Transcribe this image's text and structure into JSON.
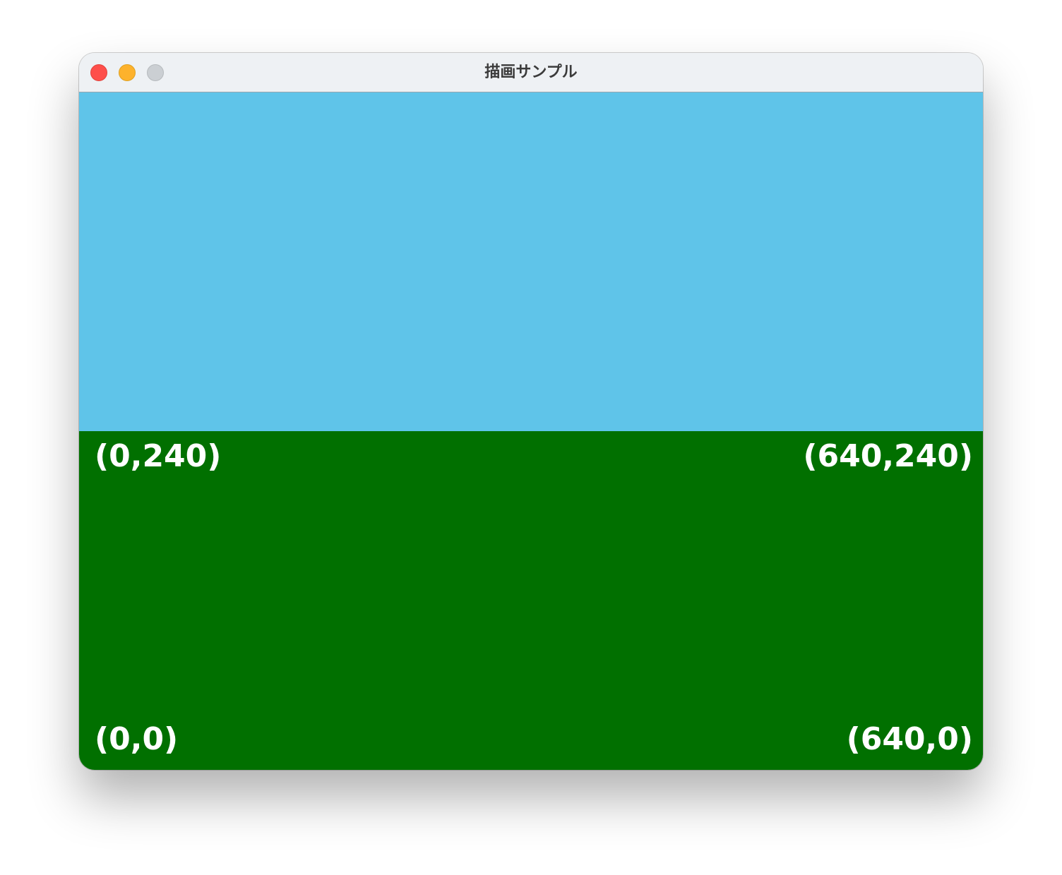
{
  "window": {
    "title": "描画サンプル",
    "controls": {
      "close": "close-icon",
      "minimize": "minimize-icon",
      "zoom": "zoom-icon"
    }
  },
  "canvas": {
    "sky_color": "#5fc4e9",
    "ground_color": "#017000",
    "labels": {
      "top_left": "(0,240)",
      "top_right": "(640,240)",
      "bottom_left": "(0,0)",
      "bottom_right": "(640,0)"
    }
  }
}
